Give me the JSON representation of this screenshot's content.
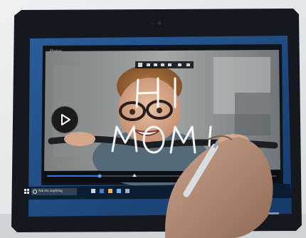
{
  "scene": {
    "description_free": true,
    "handwriting": {
      "line1": "HI",
      "line2": "MOM!"
    },
    "video_window": {
      "title": "Photos"
    },
    "taskbar": {
      "search_placeholder": "Ask me anything"
    },
    "colors": {
      "bezel": "#15191f",
      "desktop": "#1e4f8c",
      "accent": "#2d7bd6"
    }
  },
  "icons": [
    "play-icon",
    "windows-start-icon",
    "search-icon",
    "pen-icon"
  ]
}
